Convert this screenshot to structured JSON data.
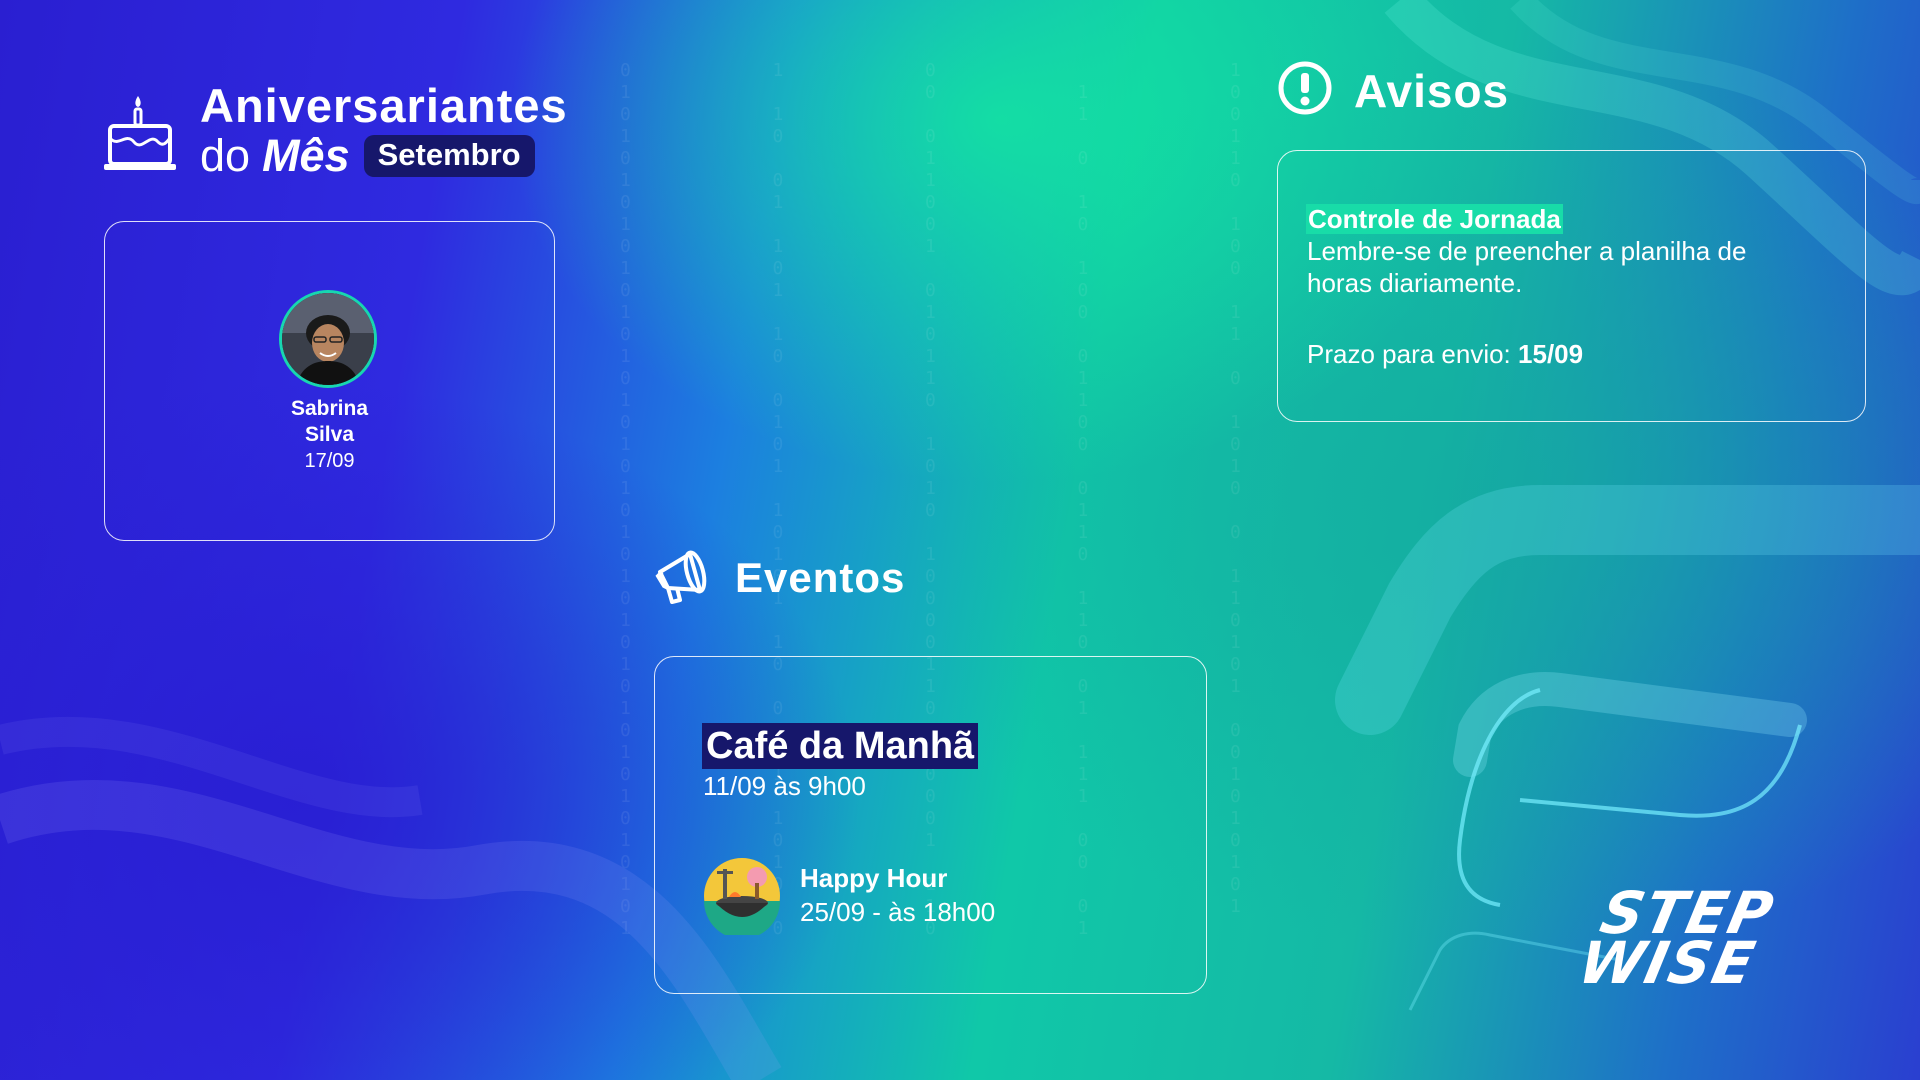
{
  "birthdays": {
    "title_line1": "Aniversariantes",
    "title_do": "do",
    "title_mes": "Mês",
    "month": "Setembro",
    "people": [
      {
        "first_name": "Sabrina",
        "last_name": "Silva",
        "date": "17/09"
      }
    ]
  },
  "notices": {
    "title": "Avisos",
    "items": [
      {
        "title": "Controle de Jornada",
        "body": "Lembre-se de preencher a planilha de horas diariamente.",
        "deadline_label": "Prazo para envio:",
        "deadline_value": "15/09"
      }
    ]
  },
  "events": {
    "title": "Eventos",
    "items": [
      {
        "title": "Café da Manhã",
        "date": "11/09  às 9h00"
      },
      {
        "title": "Happy Hour",
        "date": "25/09 - às 18h00"
      }
    ]
  },
  "logo": {
    "line1": "STEP",
    "line2": "WISE"
  },
  "colors": {
    "badge_bg": "#16176b",
    "highlight_green": "#18dca8",
    "avatar_ring": "#18d6b0"
  },
  "icons": [
    "birthday-cake-icon",
    "alert-circle-icon",
    "megaphone-icon",
    "barbecue-icon"
  ]
}
